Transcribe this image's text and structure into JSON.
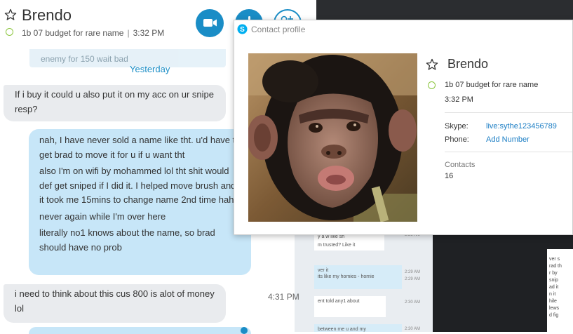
{
  "header": {
    "contact_name": "Brendo",
    "mood": "1b 07 budget for rare name",
    "separator": "|",
    "time": "3:32 PM"
  },
  "chat": {
    "faded_text": "enemy for 150 wait bad",
    "date_separator": "Yesterday",
    "messages": [
      {
        "direction": "in",
        "lines": [
          "If i buy it could u also put it on my acc on ur snipe resp?"
        ]
      },
      {
        "direction": "out",
        "lines": [
          "nah, I have never sold a name like tht. u'd have to get brad to move it for u if u want tht",
          "also I'm on wifi by mohammed lol tht shit would def get sniped if I did it. I helped move brush and it took me 15mins to change name 2nd time haha",
          "never again while I'm over here",
          "literally no1 knows about the name, so brad should have no prob"
        ]
      },
      {
        "direction": "in",
        "lines": [
          "i need to think about this cus 800 is alot of money lol"
        ],
        "time": "4:31 PM"
      }
    ]
  },
  "background_screenshot": {
    "bubbles": [
      "y a  w  like  sh",
      "m trusted? Like it",
      "ver it",
      "its like my homies - homie",
      "ent told any1 about",
      "between me u and my"
    ],
    "times": [
      "2:28 AM",
      "2:29 AM",
      "2:29 AM",
      "2:30 AM",
      "2:30 AM"
    ],
    "side_text": [
      "ver s",
      "rad th",
      "r by",
      "snip",
      "ad it",
      "n it",
      "hile",
      "lews",
      "d fig"
    ]
  },
  "profile": {
    "window_title": "Contact profile",
    "name": "Brendo",
    "mood": "1b 07 budget for rare name",
    "time": "3:32 PM",
    "skype_label": "Skype:",
    "skype_value": "live:sythe123456789",
    "phone_label": "Phone:",
    "phone_value": "Add Number",
    "contacts_label": "Contacts",
    "contacts_value": "16"
  },
  "icons": {
    "star": "star-outline-icon",
    "video": "video-camera-icon",
    "call": "phone-icon",
    "add": "add-person-icon",
    "logo": "skype-logo-icon"
  },
  "colors": {
    "accent": "#1a8dc6",
    "status_online": "#8cc63f",
    "bubble_out": "#c7e6f8",
    "bubble_in": "#e9ebee"
  }
}
